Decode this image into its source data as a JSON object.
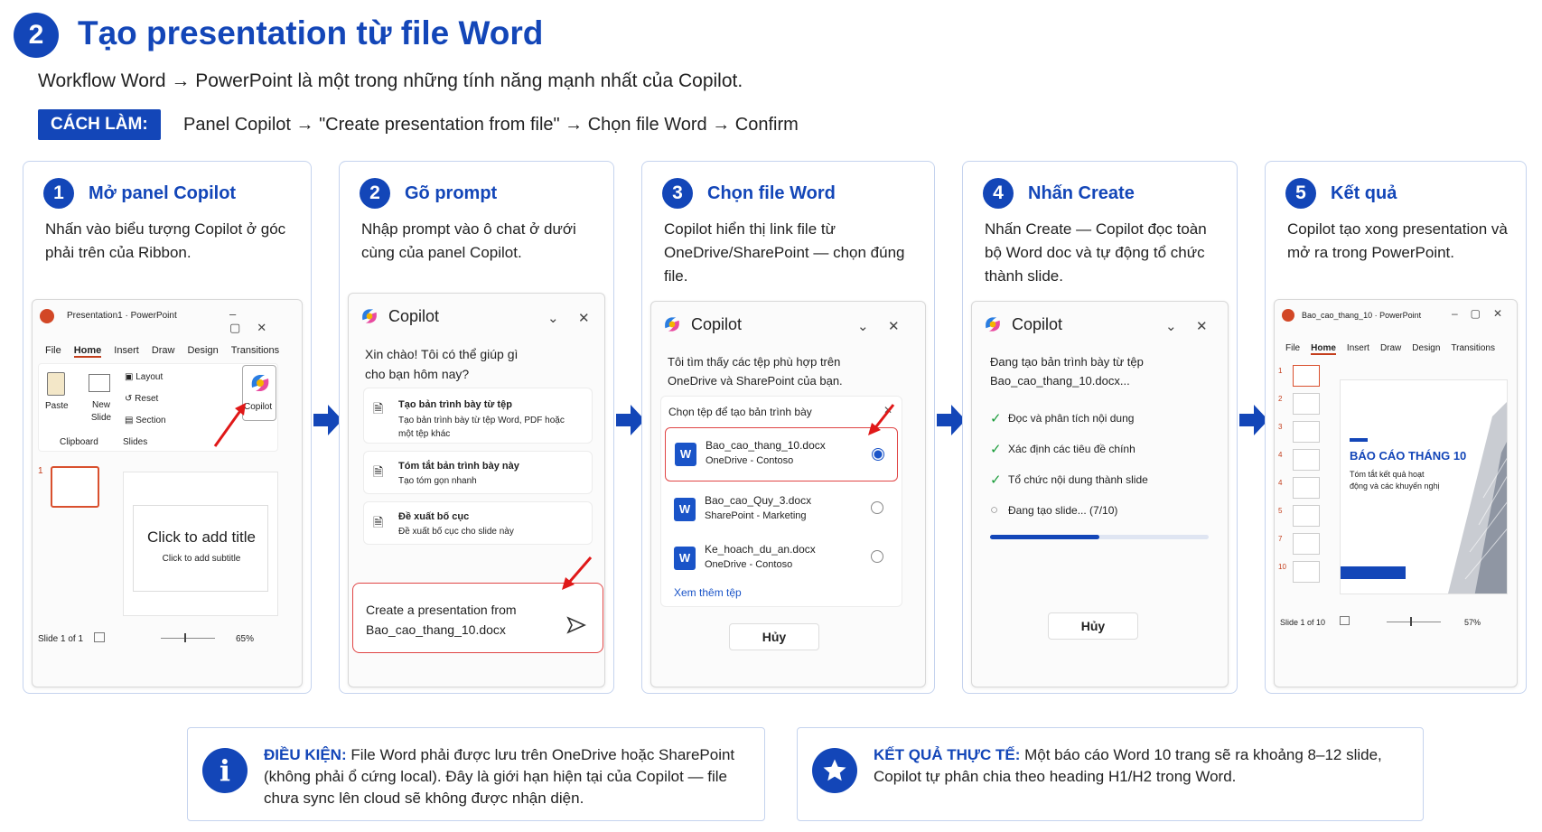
{
  "header": {
    "badge": "2",
    "title": "Tạo presentation từ file Word",
    "subtitle": "Workflow Word → PowerPoint là một trong những tính năng mạnh nhất của Copilot.",
    "howto_label": "CÁCH LÀM:",
    "howto_text": "Panel Copilot → \"Create presentation from file\" → Chọn file Word → Confirm"
  },
  "steps": [
    {
      "num": "1",
      "title": "Mở panel Copilot",
      "desc": "Nhấn vào biểu tượng Copilot ở góc phải trên của Ribbon."
    },
    {
      "num": "2",
      "title": "Gõ prompt",
      "desc": "Nhập prompt vào ô chat ở dưới cùng của panel Copilot."
    },
    {
      "num": "3",
      "title": "Chọn file Word",
      "desc": "Copilot hiển thị link file từ OneDrive/SharePoint — chọn đúng file."
    },
    {
      "num": "4",
      "title": "Nhấn Create",
      "desc": "Nhấn Create — Copilot đọc toàn bộ Word doc và tự động tổ chức thành slide."
    },
    {
      "num": "5",
      "title": "Kết quả",
      "desc": "Copilot tạo xong presentation và mở ra trong PowerPoint."
    }
  ],
  "ppt1": {
    "app_title": "Presentation1 · PowerPoint",
    "tabs": [
      "File",
      "Home",
      "Insert",
      "Draw",
      "Design",
      "Transitions"
    ],
    "paste": "Paste",
    "new_slide": "New Slide",
    "layout": "Layout",
    "reset": "Reset",
    "section": "Section",
    "copilot": "Copilot",
    "clipboard": "Clipboard",
    "slides": "Slides",
    "thumb_num": "1",
    "title_ph": "Click to add title",
    "subtitle_ph": "Click to add subtitle",
    "status": "Slide 1 of 1",
    "zoom": "65%"
  },
  "copilot2": {
    "name": "Copilot",
    "greeting": "Xin chào! Tôi có thể giúp gì cho bạn hôm nay?",
    "options": [
      {
        "title": "Tạo bản trình bày từ tệp",
        "desc": "Tạo bản trình bày từ tệp Word, PDF hoặc một tệp khác"
      },
      {
        "title": "Tóm tắt bản trình bày này",
        "desc": "Tạo tóm gọn nhanh"
      },
      {
        "title": "Đề xuất bố cục",
        "desc": "Đề xuất bố cục cho slide này"
      }
    ],
    "prompt": "Create a presentation from Bao_cao_thang_10.docx"
  },
  "copilot3": {
    "name": "Copilot",
    "message": "Tôi tìm thấy các tệp phù hợp trên OneDrive và SharePoint của bạn.",
    "picker_title": "Chọn tệp để tạo bản trình bày",
    "files": [
      {
        "name": "Bao_cao_thang_10.docx",
        "loc": "OneDrive - Contoso"
      },
      {
        "name": "Bao_cao_Quy_3.docx",
        "loc": "SharePoint - Marketing"
      },
      {
        "name": "Ke_hoach_du_an.docx",
        "loc": "OneDrive - Contoso"
      }
    ],
    "more": "Xem thêm tệp",
    "cancel": "Hủy"
  },
  "copilot4": {
    "name": "Copilot",
    "message": "Đang tạo bản trình bày từ tệp Bao_cao_thang_10.docx...",
    "tasks": [
      "Đọc và phân tích nội dung",
      "Xác định các tiêu đề chính",
      "Tổ chức nội dung thành slide",
      "Đang tạo slide... (7/10)"
    ],
    "progress": 0.5,
    "cancel": "Hủy"
  },
  "ppt5": {
    "app_title": "Bao_cao_thang_10 · PowerPoint",
    "tabs": [
      "File",
      "Home",
      "Insert",
      "Draw",
      "Design",
      "Transitions"
    ],
    "thumbs": [
      "1",
      "2",
      "3",
      "4",
      "4",
      "5",
      "7",
      "10"
    ],
    "slide_title": "BÁO CÁO THÁNG 10",
    "slide_sub": "Tóm tắt kết quả hoạt động và các khuyến nghị",
    "status": "Slide 1 of 10",
    "zoom": "57%"
  },
  "notes": [
    {
      "label": "ĐIỀU KIỆN:",
      "text": "File Word phải được lưu trên OneDrive hoặc SharePoint (không phải ổ cứng local). Đây là giới hạn hiện tại của Copilot — file chưa sync lên cloud sẽ không được nhận diện.",
      "icon": "i"
    },
    {
      "label": "KẾT QUẢ THỰC TẾ:",
      "text": "Một báo cáo Word 10 trang sẽ ra khoảng 8–12 slide, Copilot tự phân chia theo heading H1/H2 trong Word.",
      "icon": "star"
    }
  ]
}
